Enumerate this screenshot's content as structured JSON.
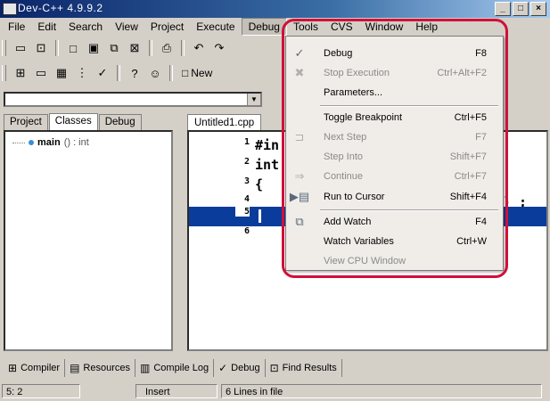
{
  "window": {
    "title": "Dev-C++ 4.9.9.2"
  },
  "menubar": [
    "File",
    "Edit",
    "Search",
    "View",
    "Project",
    "Execute",
    "Debug",
    "Tools",
    "CVS",
    "Window",
    "Help"
  ],
  "toolbar": {
    "new_label": "New"
  },
  "left_panel": {
    "tabs": [
      "Project",
      "Classes",
      "Debug"
    ],
    "active_tab": "Classes",
    "tree": {
      "name": "main",
      "signature": "() : int"
    }
  },
  "editor": {
    "tab": "Untitled1.cpp",
    "lines": [
      {
        "num": "1",
        "code": "#in"
      },
      {
        "num": "2",
        "code": "int"
      },
      {
        "num": "3",
        "code": "{"
      },
      {
        "num": "4",
        "code": ""
      },
      {
        "num": "5",
        "code": ""
      },
      {
        "num": "6",
        "code": ""
      }
    ],
    "line4_tail": ") ;"
  },
  "debug_menu": {
    "items": [
      {
        "label": "Debug",
        "shortcut": "F8",
        "icon": "check-icon",
        "enabled": true
      },
      {
        "label": "Stop Execution",
        "shortcut": "Ctrl+Alt+F2",
        "icon": "stop-icon",
        "enabled": false
      },
      {
        "label": "Parameters...",
        "shortcut": "",
        "icon": "",
        "enabled": true
      },
      {
        "label": "Toggle Breakpoint",
        "shortcut": "Ctrl+F5",
        "icon": "",
        "enabled": true
      },
      {
        "label": "Next Step",
        "shortcut": "F7",
        "icon": "next-step-icon",
        "enabled": false
      },
      {
        "label": "Step Into",
        "shortcut": "Shift+F7",
        "icon": "",
        "enabled": false
      },
      {
        "label": "Continue",
        "shortcut": "Ctrl+F7",
        "icon": "continue-icon",
        "enabled": false
      },
      {
        "label": "Run to Cursor",
        "shortcut": "Shift+F4",
        "icon": "run-to-cursor-icon",
        "enabled": true
      },
      {
        "label": "Add Watch",
        "shortcut": "F4",
        "icon": "add-watch-icon",
        "enabled": true
      },
      {
        "label": "Watch Variables",
        "shortcut": "Ctrl+W",
        "icon": "",
        "enabled": true
      },
      {
        "label": "View CPU Window",
        "shortcut": "",
        "icon": "",
        "enabled": false
      }
    ]
  },
  "bottom_tabs": [
    "Compiler",
    "Resources",
    "Compile Log",
    "Debug",
    "Find Results"
  ],
  "status": {
    "position": "5: 2",
    "mode": "Insert",
    "info": "6 Lines in file"
  },
  "colors": {
    "highlight_border": "#d0103a",
    "selection": "#0a3c9b"
  }
}
